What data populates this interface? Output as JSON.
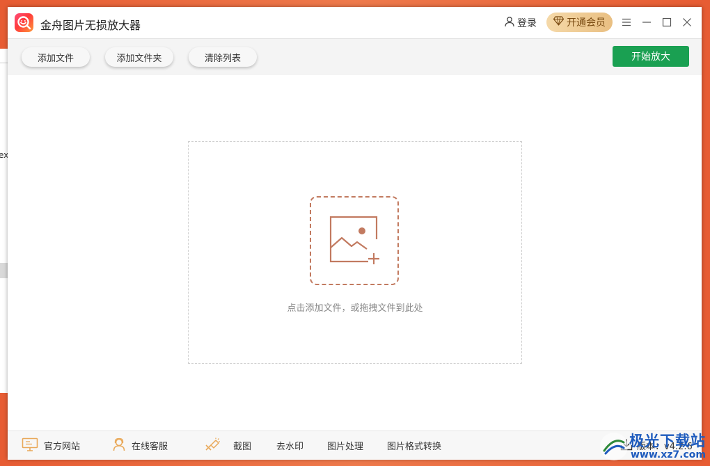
{
  "app": {
    "title": "金舟图片无损放大器"
  },
  "header": {
    "login_label": "登录",
    "vip_label": "开通会员"
  },
  "toolbar": {
    "add_file": "添加文件",
    "add_folder": "添加文件夹",
    "clear_list": "清除列表",
    "start": "开始放大"
  },
  "dropzone": {
    "hint": "点击添加文件，或拖拽文件到此处"
  },
  "footer": {
    "website": "官方网站",
    "support": "在线客服",
    "screenshot": "截图",
    "watermark_remove": "去水印",
    "image_process": "图片处理",
    "format_convert": "图片格式转换",
    "version": "版本：v4.2.6"
  },
  "background": {
    "partial_text": "ex"
  },
  "watermark": {
    "title": "极光下载站",
    "url": "www.xz7.com"
  },
  "colors": {
    "accent_green": "#1aa052",
    "vip_gold": "#e9bf82",
    "drop_icon": "#c27a60",
    "footer_icon": "#e9a95a",
    "desktop": "#e8683e"
  },
  "icons": {
    "logo": "app-logo-icon",
    "user": "user-icon",
    "diamond": "diamond-icon",
    "menu": "menu-icon",
    "minimize": "minimize-icon",
    "maximize": "maximize-icon",
    "close": "close-icon",
    "add_image": "add-image-icon",
    "monitor": "monitor-icon",
    "headset": "customer-service-icon",
    "scissors": "screenshot-icon",
    "download": "download-icon"
  }
}
